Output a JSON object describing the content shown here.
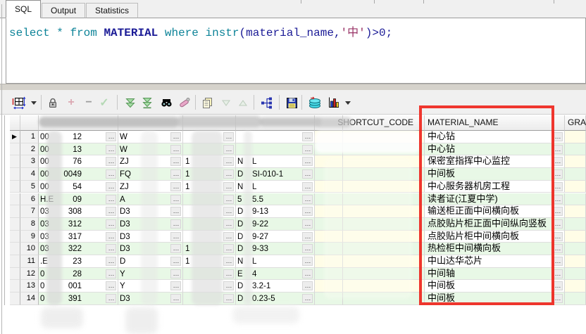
{
  "tabs": {
    "items": [
      {
        "label": "SQL",
        "active": true
      },
      {
        "label": "Output",
        "active": false
      },
      {
        "label": "Statistics",
        "active": false
      }
    ]
  },
  "editor": {
    "tokens": [
      {
        "text": "select",
        "color": "#0d8398"
      },
      {
        "text": " ",
        "color": "#000000"
      },
      {
        "text": "*",
        "color": "#0d8398"
      },
      {
        "text": " ",
        "color": "#000000"
      },
      {
        "text": "from",
        "color": "#0d8398"
      },
      {
        "text": " ",
        "color": "#000000"
      },
      {
        "text": "MATERIAL",
        "color": "#1a1a96",
        "bold": true
      },
      {
        "text": " ",
        "color": "#000000"
      },
      {
        "text": "where",
        "color": "#0d8398"
      },
      {
        "text": " ",
        "color": "#000000"
      },
      {
        "text": "instr",
        "color": "#0d8398"
      },
      {
        "text": "(material_name,",
        "color": "#1a1a96"
      },
      {
        "text": "'中'",
        "color": "#993366"
      },
      {
        "text": ")>0;",
        "color": "#1a1a96"
      }
    ]
  },
  "toolbar": {
    "icon_names": [
      "grid-options-icon",
      "dropdown-caret-icon",
      "lock-icon",
      "add-record-icon",
      "delete-record-icon",
      "post-changes-icon",
      "fetch-next-icon",
      "fetch-all-icon",
      "find-icon",
      "highlight-icon",
      "copy-results-icon",
      "sort-descending-icon",
      "sort-ascending-icon",
      "structure-icon",
      "save-results-icon",
      "record-stack-icon",
      "chart-icon",
      "chart-caret-icon"
    ]
  },
  "grid": {
    "ellipsis": "…",
    "headers": {
      "c1": "",
      "c2": "",
      "c3": "",
      "c4": "",
      "c5": "",
      "c6": "SHORTCUT_CODE",
      "name": "MATERIAL_NAME",
      "gram": "GRAM"
    },
    "rows": [
      {
        "n": "1",
        "c1a": "00",
        "c1b": "12",
        "c2": "W",
        "c3": "",
        "c4a": "",
        "c4b": "",
        "name": "中心钻"
      },
      {
        "n": "2",
        "c1a": "00",
        "c1b": "13",
        "c2": "W",
        "c3": "",
        "c4a": "",
        "c4b": "",
        "name": "中心钻"
      },
      {
        "n": "3",
        "c1a": "00",
        "c1b": "76",
        "c2": "ZJ",
        "c3": "1",
        "c4a": "N",
        "c4b": "L",
        "name": "保密室指挥中心监控"
      },
      {
        "n": "4",
        "c1a": "00",
        "c1b": "0049",
        "c2": "FQ",
        "c3": "1",
        "c4a": "D",
        "c4b": "SI-010-1",
        "name": "中间板"
      },
      {
        "n": "5",
        "c1a": "00",
        "c1b": "54",
        "c2": "ZJ",
        "c3": "1",
        "c4a": "N",
        "c4b": "L",
        "name": "中心服务器机房工程"
      },
      {
        "n": "6",
        "c1a": "H.E",
        "c1b": "09",
        "c2": "A",
        "c3": "",
        "c4a": "5",
        "c4b": "5.5",
        "name": "读者证(江夏中学)"
      },
      {
        "n": "7",
        "c1a": "03",
        "c1b": "308",
        "c2": "D3",
        "c3": "",
        "c4a": "D",
        "c4b": "9-13",
        "name": "输送柜正面中间横向板"
      },
      {
        "n": "8",
        "c1a": "03",
        "c1b": "312",
        "c2": "D3",
        "c3": "",
        "c4a": "D",
        "c4b": "9-22",
        "name": "点胶贴片柜正面中间纵向竖板"
      },
      {
        "n": "9",
        "c1a": "03",
        "c1b": "317",
        "c2": "D3",
        "c3": "",
        "c4a": "D",
        "c4b": "9-27",
        "name": "点胶贴片柜中间横向板"
      },
      {
        "n": "10",
        "c1a": "03",
        "c1b": "322",
        "c2": "D3",
        "c3": "1",
        "c4a": "D",
        "c4b": "9-33",
        "name": "热检柜中间横向板"
      },
      {
        "n": "11",
        "c1a": ".E",
        "c1b": "23",
        "c2": "D",
        "c3": "1",
        "c4a": "N",
        "c4b": "L",
        "name": "中山达华芯片"
      },
      {
        "n": "12",
        "c1a": "0",
        "c1b": "28",
        "c2": "Y",
        "c3": "",
        "c4a": "E",
        "c4b": "4",
        "name": "中间轴"
      },
      {
        "n": "13",
        "c1a": "0",
        "c1b": "001",
        "c2": "Y",
        "c3": "",
        "c4a": "D",
        "c4b": "3.2-1",
        "name": "中间板"
      },
      {
        "n": "14",
        "c1a": "0",
        "c1b": "391",
        "c2": "D3",
        "c3": "",
        "c4a": "D",
        "c4b": "0.23-5",
        "name": "中间板"
      }
    ]
  },
  "annotation": {
    "color": "#ee2b23"
  }
}
